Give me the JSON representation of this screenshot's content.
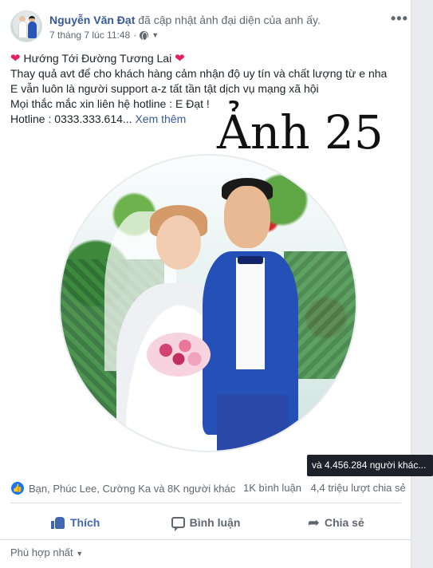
{
  "post": {
    "author": "Nguyễn Văn Đạt",
    "action": "đã cập nhật ảnh đại diện của anh ấy.",
    "timestamp": "7 tháng 7 lúc 11:48",
    "privacy_icon": "globe-icon",
    "more_label": "•••",
    "text": {
      "line1": "Hướng Tới Đường Tương Lai",
      "line2": "Thay quả avt để cho khách hàng cảm nhận độ uy tín và chất lượng từ e nha",
      "line3": "E vẫn luôn là người support a-z tất tần tật dịch vụ mạng xã hội",
      "line4": "Mọi thắc mắc xin liên hệ hotline : E Đạt !",
      "line5": "Hotline : 0333.333.614...",
      "see_more": "Xem thêm"
    },
    "watermark": "Ảnh 25"
  },
  "tooltip": "và 4.456.284 người khác...",
  "reactions": {
    "names": "Bạn, Phúc Lee, Cường Ka và 8K người khác",
    "comments": "1K bình luận",
    "shares": "4,4 triệu lượt chia sẻ"
  },
  "actions": {
    "like": "Thích",
    "comment": "Bình luận",
    "share": "Chia sẻ"
  },
  "sort": {
    "label": "Phù hợp nhất"
  },
  "colors": {
    "link": "#385898",
    "like_blue": "#4267b2",
    "heart": "#e0245e"
  }
}
